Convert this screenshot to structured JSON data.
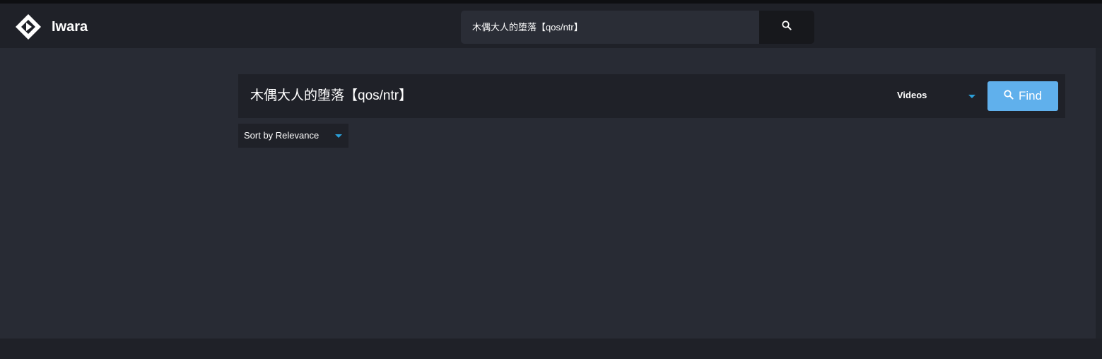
{
  "header": {
    "brand": "Iwara",
    "search_value": "木偶大人的堕落【qos/ntr】",
    "search_icon": "search-icon",
    "logo_icon": "iwara-logo-icon"
  },
  "search_panel": {
    "query": "木偶大人的堕落【qos/ntr】",
    "type_selected": "Videos",
    "find_label": "Find",
    "find_icon": "search-icon"
  },
  "sort": {
    "selected": "Sort by Relevance"
  },
  "colors": {
    "header_bg": "#1f2128",
    "page_bg": "#282b34",
    "accent": "#60b0ec",
    "caret": "#2b9fd8"
  }
}
